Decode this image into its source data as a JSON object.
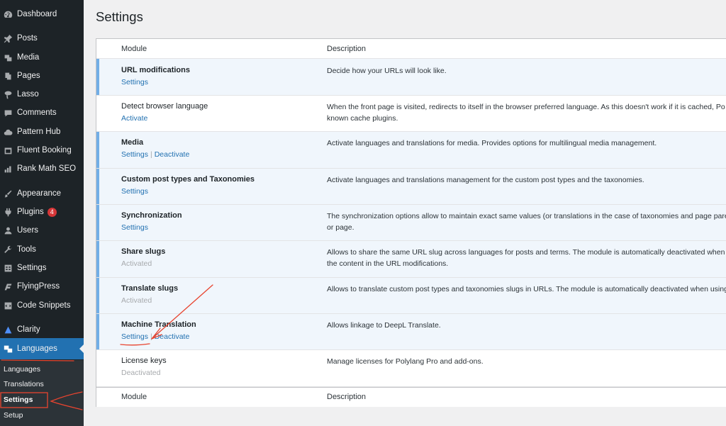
{
  "sidebar": {
    "items": [
      {
        "label": "Dashboard",
        "icon": "dashboard-icon"
      },
      {
        "label": "Posts",
        "icon": "pin-icon"
      },
      {
        "label": "Media",
        "icon": "media-icon"
      },
      {
        "label": "Pages",
        "icon": "pages-icon"
      },
      {
        "label": "Lasso",
        "icon": "lasso-icon"
      },
      {
        "label": "Comments",
        "icon": "comment-icon"
      },
      {
        "label": "Pattern Hub",
        "icon": "cloud-icon"
      },
      {
        "label": "Fluent Booking",
        "icon": "calendar-icon"
      },
      {
        "label": "Rank Math SEO",
        "icon": "chart-icon"
      },
      {
        "label": "Appearance",
        "icon": "paintbrush-icon"
      },
      {
        "label": "Plugins",
        "icon": "plugin-icon",
        "badge": "4"
      },
      {
        "label": "Users",
        "icon": "user-icon"
      },
      {
        "label": "Tools",
        "icon": "wrench-icon"
      },
      {
        "label": "Settings",
        "icon": "settings-icon"
      },
      {
        "label": "FlyingPress",
        "icon": "flyingpress-icon"
      },
      {
        "label": "Code Snippets",
        "icon": "code-icon"
      },
      {
        "label": "Clarity",
        "icon": "clarity-icon"
      },
      {
        "label": "Languages",
        "icon": "translation-icon"
      }
    ],
    "submenu": [
      "Languages",
      "Translations",
      "Settings",
      "Setup"
    ]
  },
  "page": {
    "title": "Settings"
  },
  "table": {
    "header": {
      "module": "Module",
      "description": "Description"
    },
    "footer": {
      "module": "Module",
      "description": "Description"
    },
    "rows": [
      {
        "name": "URL modifications",
        "link1": "Settings",
        "desc1": "Decide how your URLs will look like.",
        "desc2": ""
      },
      {
        "name": "Detect browser language",
        "link1": "Activate",
        "desc1": "When the front page is visited, redirects to itself in the browser preferred language. As this doesn't work if it is cached, Po",
        "desc2": "known cache plugins."
      },
      {
        "name": "Media",
        "link1": "Settings",
        "link2": "Deactivate",
        "desc1": "Activate languages and translations for media. Provides options for multilingual media management.",
        "desc2": ""
      },
      {
        "name": "Custom post types and Taxonomies",
        "link1": "Settings",
        "desc1": "Activate languages and translations management for the custom post types and the taxonomies.",
        "desc2": ""
      },
      {
        "name": "Synchronization",
        "link1": "Settings",
        "desc1": "The synchronization options allow to maintain exact same values (or translations in the case of taxonomies and page pare",
        "desc2": "or page."
      },
      {
        "name": "Share slugs",
        "status": "Activated",
        "desc1": "Allows to share the same URL slug across languages for posts and terms. The module is automatically deactivated when u",
        "desc2": "the content in the URL modifications."
      },
      {
        "name": "Translate slugs",
        "status": "Activated",
        "desc1": "Allows to translate custom post types and taxonomies slugs in URLs. The module is automatically deactivated when using",
        "desc2": ""
      },
      {
        "name": "Machine Translation",
        "link1": "Settings",
        "link2": "Deactivate",
        "desc1": "Allows linkage to DeepL Translate.",
        "desc2": ""
      },
      {
        "name": "License keys",
        "status": "Deactivated",
        "desc1": "Manage licenses for Polylang Pro and add-ons.",
        "desc2": ""
      }
    ],
    "separator": "|"
  },
  "colors": {
    "accent": "#2271b1",
    "sidebar": "#1d2327",
    "annotation": "#e8442f"
  }
}
